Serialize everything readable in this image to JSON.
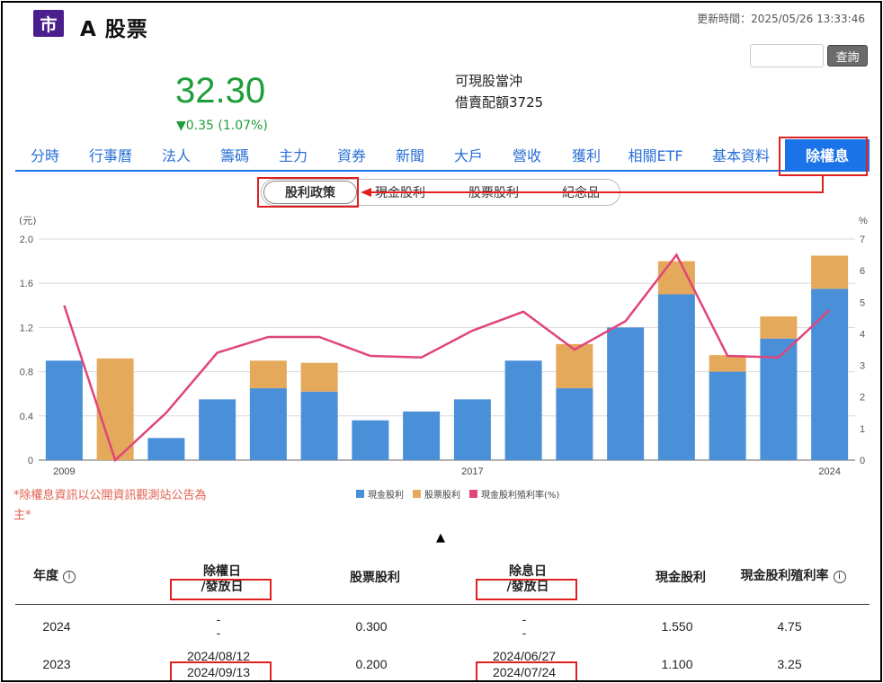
{
  "header": {
    "market_badge": "市",
    "stock_name": "A 股票",
    "update_time": "更新時間：2025/05/26 13:33:46",
    "search_button": "查詢",
    "search_value": ""
  },
  "quote": {
    "price": "32.30",
    "change": "▼0.35 (1.07%)",
    "note_line1": "可現股當沖",
    "note_line2": "借賣配額3725"
  },
  "tabs": [
    "分時",
    "行事曆",
    "法人",
    "籌碼",
    "主力",
    "資券",
    "新聞",
    "大戶",
    "營收",
    "獲利",
    "相關ETF",
    "基本資料",
    "除權息"
  ],
  "active_tab": "除權息",
  "subtabs": [
    "股利政策",
    "現金股利",
    "股票股利",
    "紀念品"
  ],
  "active_subtab": "股利政策",
  "colors": {
    "cash": "#4a90d9",
    "stock": "#e5a95b",
    "yield": "#e0457b",
    "accent": "#1a73e8",
    "price_down": "#1e9e3a",
    "highlight": "#e02020"
  },
  "chart_data": {
    "type": "bar",
    "stacked": true,
    "categories": [
      "2009",
      "2010",
      "2011",
      "2012",
      "2013",
      "2014",
      "2015",
      "2016",
      "2017",
      "2018",
      "2019",
      "2020",
      "2021",
      "2022",
      "2023",
      "2024"
    ],
    "x_tick_labels": [
      "2009",
      "2017",
      "2024"
    ],
    "series": [
      {
        "name": "現金股利",
        "type": "bar",
        "axis": "left",
        "values": [
          0.9,
          0.0,
          0.2,
          0.55,
          0.65,
          0.62,
          0.36,
          0.44,
          0.55,
          0.9,
          0.65,
          1.2,
          1.5,
          0.8,
          1.1,
          1.55
        ]
      },
      {
        "name": "股票股利",
        "type": "bar",
        "axis": "left",
        "values": [
          0.0,
          0.92,
          0.0,
          0.0,
          0.25,
          0.26,
          0.0,
          0.0,
          0.0,
          0.0,
          0.4,
          0.0,
          0.3,
          0.15,
          0.2,
          0.3
        ]
      },
      {
        "name": "現金股利殖利率(%)",
        "type": "line",
        "axis": "right",
        "values": [
          4.9,
          0.0,
          1.5,
          3.4,
          3.9,
          3.9,
          3.3,
          3.25,
          4.1,
          4.7,
          3.5,
          4.4,
          6.5,
          3.3,
          3.25,
          4.75
        ]
      }
    ],
    "y_left": {
      "unit": "(元)",
      "min": 0,
      "max": 2.0,
      "ticks": [
        "0",
        "0.4",
        "0.8",
        "1.2",
        "1.6",
        "2.0"
      ]
    },
    "y_right": {
      "unit": "%",
      "min": 0,
      "max": 7,
      "ticks": [
        "0",
        "1",
        "2",
        "3",
        "4",
        "5",
        "6",
        "7"
      ]
    },
    "grid": true,
    "legend_position": "bottom"
  },
  "disclaimer": "*除權息資訊以公開資訊觀測站公告為主*",
  "collapse_arrow": "▲",
  "table": {
    "headers": {
      "year": "年度",
      "ex_right_1": "除權日",
      "ex_right_2": "/發放日",
      "stock_dividend": "股票股利",
      "ex_div_1": "除息日",
      "ex_div_2": "/發放日",
      "cash_dividend": "現金股利",
      "yield": "現金股利殖利率"
    },
    "rows": [
      {
        "year": "2024",
        "ex_right_date": "-",
        "ex_right_pay": "-",
        "stock_div": "0.300",
        "ex_div_date": "-",
        "ex_div_pay": "-",
        "cash_div": "1.550",
        "yield": "4.75"
      },
      {
        "year": "2023",
        "ex_right_date": "2024/08/12",
        "ex_right_pay": "2024/09/13",
        "stock_div": "0.200",
        "ex_div_date": "2024/06/27",
        "ex_div_pay": "2024/07/24",
        "cash_div": "1.100",
        "yield": "3.25"
      }
    ]
  }
}
